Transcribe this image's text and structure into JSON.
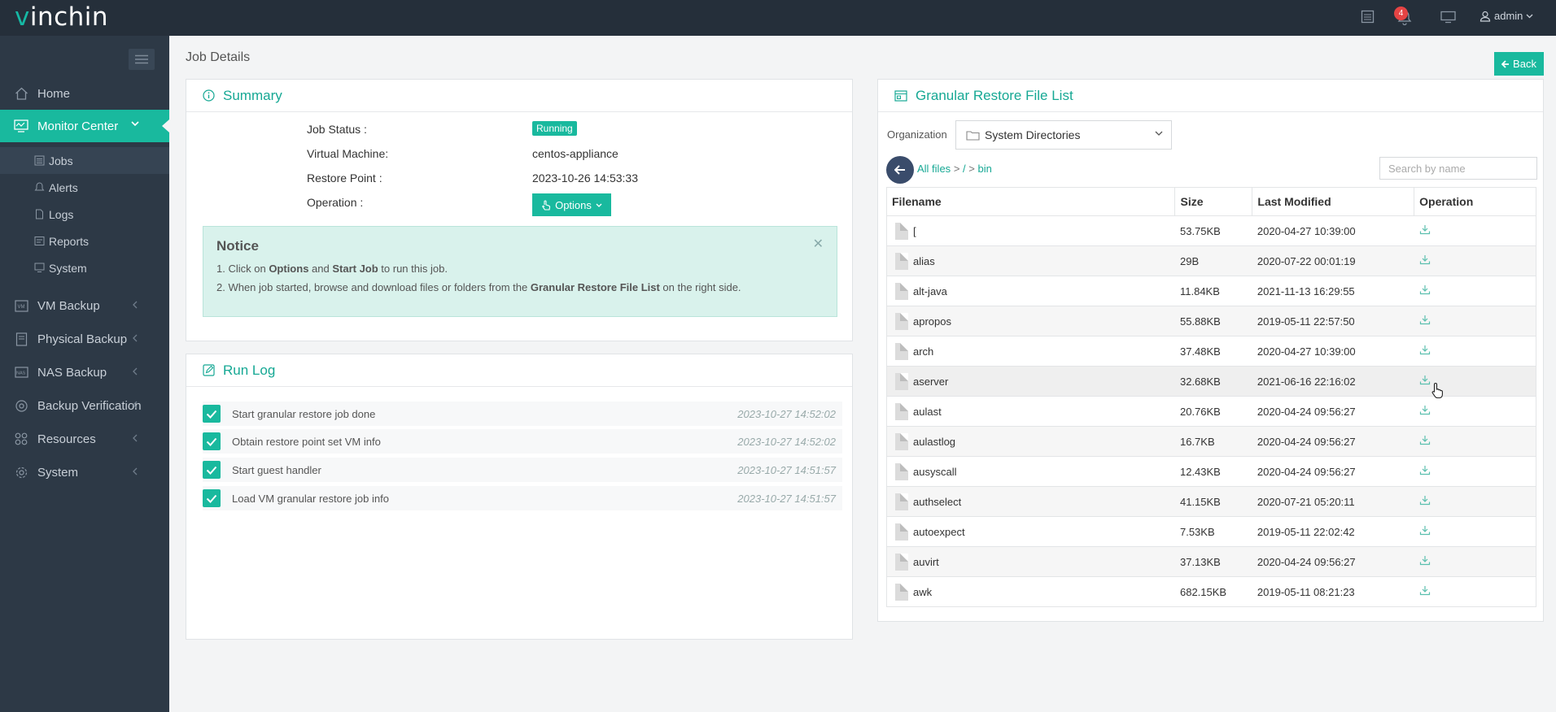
{
  "app": {
    "logo_v": "v",
    "logo_rest": "inchin"
  },
  "topbar": {
    "notification_count": "4",
    "user": "admin"
  },
  "sidebar": {
    "items": [
      {
        "label": "Home",
        "icon": "home-icon"
      },
      {
        "label": "Monitor Center",
        "icon": "monitor-icon",
        "active": true
      },
      {
        "label": "VM Backup",
        "icon": "vm-icon"
      },
      {
        "label": "Physical Backup",
        "icon": "server-icon"
      },
      {
        "label": "NAS Backup",
        "icon": "nas-icon"
      },
      {
        "label": "Backup Verification",
        "icon": "verify-icon"
      },
      {
        "label": "Resources",
        "icon": "grid-icon"
      },
      {
        "label": "System",
        "icon": "gear-icon"
      }
    ],
    "subitems": [
      {
        "label": "Jobs",
        "icon": "list-icon",
        "selected": true
      },
      {
        "label": "Alerts",
        "icon": "bell-icon"
      },
      {
        "label": "Logs",
        "icon": "file-icon"
      },
      {
        "label": "Reports",
        "icon": "report-icon"
      },
      {
        "label": "System",
        "icon": "system-icon"
      }
    ]
  },
  "page": {
    "breadcrumb": "Job Details",
    "back_label": "Back"
  },
  "summary": {
    "title": "Summary",
    "fields": [
      {
        "label": "Job Status :",
        "value": "Running"
      },
      {
        "label": "Virtual Machine:",
        "value": "centos-appliance"
      },
      {
        "label": "Restore Point :",
        "value": "2023-10-26 14:53:33"
      },
      {
        "label": "Operation :",
        "value": "Options"
      }
    ],
    "notice": {
      "title": "Notice",
      "line1": {
        "a": "1. Click on ",
        "b": "Options",
        "c": " and ",
        "d": "Start Job",
        "e": " to run this job."
      },
      "line2": {
        "a": "2. When job started, browse and download files or folders from the ",
        "b": "Granular Restore File List",
        "c": " on the right side."
      }
    }
  },
  "runlog": {
    "title": "Run Log",
    "entries": [
      {
        "text": "Start granular restore job done",
        "time": "2023-10-27 14:52:02"
      },
      {
        "text": "Obtain restore point set VM info",
        "time": "2023-10-27 14:52:02"
      },
      {
        "text": "Start guest handler",
        "time": "2023-10-27 14:51:57"
      },
      {
        "text": "Load VM granular restore job info",
        "time": "2023-10-27 14:51:57"
      }
    ]
  },
  "filelist": {
    "title": "Granular Restore File List",
    "org_label": "Organization",
    "org_value": "System Directories",
    "crumbs": [
      "All files",
      "/",
      "bin"
    ],
    "search_placeholder": "Search by name",
    "columns": [
      "Filename",
      "Size",
      "Last Modified",
      "Operation"
    ],
    "rows": [
      {
        "name": "[",
        "size": "53.75KB",
        "modified": "2020-04-27 10:39:00"
      },
      {
        "name": "alias",
        "size": "29B",
        "modified": "2020-07-22 00:01:19"
      },
      {
        "name": "alt-java",
        "size": "11.84KB",
        "modified": "2021-11-13 16:29:55"
      },
      {
        "name": "apropos",
        "size": "55.88KB",
        "modified": "2019-05-11 22:57:50"
      },
      {
        "name": "arch",
        "size": "37.48KB",
        "modified": "2020-04-27 10:39:00"
      },
      {
        "name": "aserver",
        "size": "32.68KB",
        "modified": "2021-06-16 22:16:02"
      },
      {
        "name": "aulast",
        "size": "20.76KB",
        "modified": "2020-04-24 09:56:27"
      },
      {
        "name": "aulastlog",
        "size": "16.7KB",
        "modified": "2020-04-24 09:56:27"
      },
      {
        "name": "ausyscall",
        "size": "12.43KB",
        "modified": "2020-04-24 09:56:27"
      },
      {
        "name": "authselect",
        "size": "41.15KB",
        "modified": "2020-07-21 05:20:11"
      },
      {
        "name": "autoexpect",
        "size": "7.53KB",
        "modified": "2019-05-11 22:02:42"
      },
      {
        "name": "auvirt",
        "size": "37.13KB",
        "modified": "2020-04-24 09:56:27"
      },
      {
        "name": "awk",
        "size": "682.15KB",
        "modified": "2019-05-11 08:21:23"
      }
    ]
  },
  "colors": {
    "accent": "#19b99e",
    "topbar": "#252f3a",
    "sidebar": "#2d3946"
  }
}
